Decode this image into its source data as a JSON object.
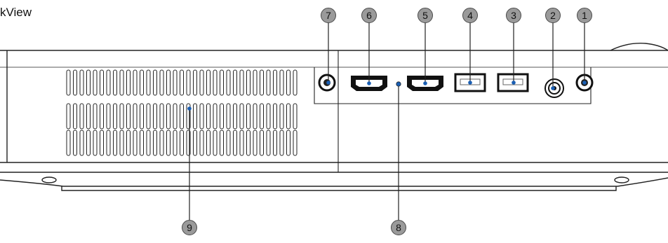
{
  "title": "kView",
  "callouts": [
    "1",
    "2",
    "3",
    "4",
    "5",
    "6",
    "7",
    "8",
    "9"
  ]
}
